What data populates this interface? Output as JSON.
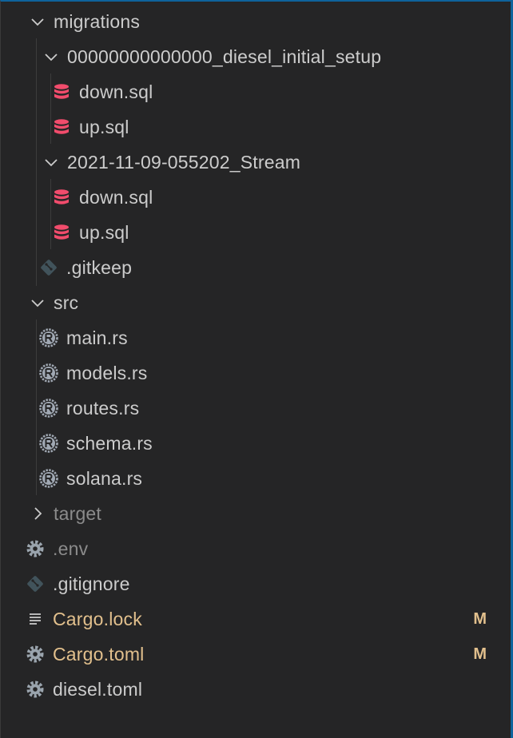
{
  "colors": {
    "background": "#252526",
    "text": "#cccccc",
    "dim_text": "#8b8b8b",
    "modified": "#e2c08d",
    "database_icon": "#f14c6c",
    "rust_icon": "#a0a8b3",
    "git_icon": "#41535b",
    "gear_icon": "#9aa4ad"
  },
  "tree": [
    {
      "label": "migrations",
      "icon": "chevron-down-icon"
    },
    {
      "label": "00000000000000_diesel_initial_setup",
      "icon": "chevron-down-icon"
    },
    {
      "label": "down.sql",
      "icon": "database-icon"
    },
    {
      "label": "up.sql",
      "icon": "database-icon"
    },
    {
      "label": "2021-11-09-055202_Stream",
      "icon": "chevron-down-icon"
    },
    {
      "label": "down.sql",
      "icon": "database-icon"
    },
    {
      "label": "up.sql",
      "icon": "database-icon"
    },
    {
      "label": ".gitkeep",
      "icon": "git-icon"
    },
    {
      "label": "src",
      "icon": "chevron-down-icon"
    },
    {
      "label": "main.rs",
      "icon": "rust-icon"
    },
    {
      "label": "models.rs",
      "icon": "rust-icon"
    },
    {
      "label": "routes.rs",
      "icon": "rust-icon"
    },
    {
      "label": "schema.rs",
      "icon": "rust-icon"
    },
    {
      "label": "solana.rs",
      "icon": "rust-icon"
    },
    {
      "label": "target",
      "icon": "chevron-right-icon"
    },
    {
      "label": ".env",
      "icon": "gear-icon"
    },
    {
      "label": ".gitignore",
      "icon": "git-icon"
    },
    {
      "label": "Cargo.lock",
      "icon": "lines-icon",
      "badge": "M"
    },
    {
      "label": "Cargo.toml",
      "icon": "gear-icon",
      "badge": "M"
    },
    {
      "label": "diesel.toml",
      "icon": "gear-icon"
    }
  ]
}
